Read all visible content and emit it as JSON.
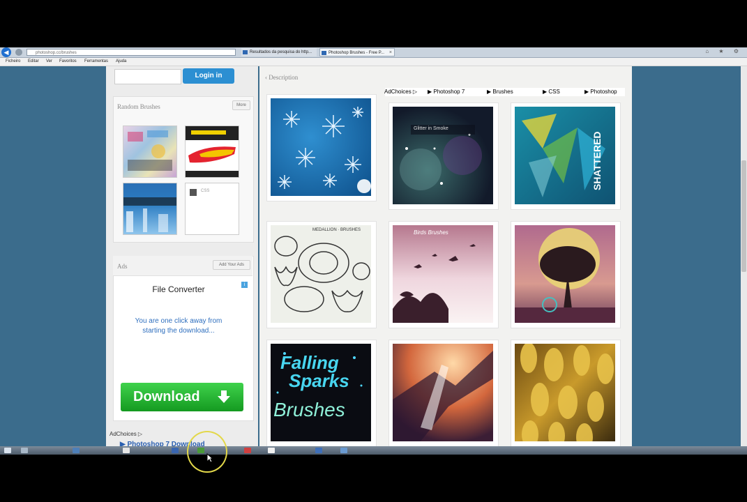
{
  "browser": {
    "address": "photoshop.cc/brushes",
    "tabs": [
      {
        "label": "Resultados da pesquisa do http..."
      },
      {
        "label": "Photoshop Brushes - Free P...",
        "close": "×"
      }
    ],
    "window_controls": "⌂ ★ ⚙",
    "menu": [
      "Ficheiro",
      "Editar",
      "Ver",
      "Favoritos",
      "Ferramentas",
      "Ajuda"
    ]
  },
  "sidebar": {
    "login_button": "Login in",
    "random_brushes": {
      "title": "Random Brushes",
      "more_button": "More",
      "css_label": "CSS"
    },
    "ads": {
      "title": "Ads",
      "add_button": "Add Your Ads",
      "ad_title": "File Converter",
      "ad_text_1": "You are one click away from",
      "ad_text_2": "starting the download...",
      "download_label": "Download",
      "adchoices": "AdChoices ▷",
      "link": "▶ Photoshop 7 Download"
    }
  },
  "main": {
    "description": "‹ Description",
    "adchoices": "AdChoices ▷",
    "ad_links": [
      "▶ Photoshop 7",
      "▶ Brushes",
      "▶ CSS",
      "▶ Photoshop"
    ],
    "brushes": [
      {
        "name": "Snowflakes"
      },
      {
        "name": "Glitter Smoke",
        "caption": "Glitter in Smoke"
      },
      {
        "name": "Shattered",
        "caption": "SHATTERED"
      },
      {
        "name": "Ornaments",
        "caption": "MEDALLION · BRUSHES"
      },
      {
        "name": "Birds",
        "caption": "Birds Brushes"
      },
      {
        "name": "Tree Moon"
      },
      {
        "name": "Falling Sparks",
        "caption_1": "Falling",
        "caption_2": "Sparks",
        "caption_3": "Brushes"
      },
      {
        "name": "Light Burst"
      },
      {
        "name": "Leaves"
      }
    ]
  },
  "colors": {
    "page_bg": "#3b6c8c",
    "login": "#2c8fd2",
    "download": "#149a20"
  }
}
